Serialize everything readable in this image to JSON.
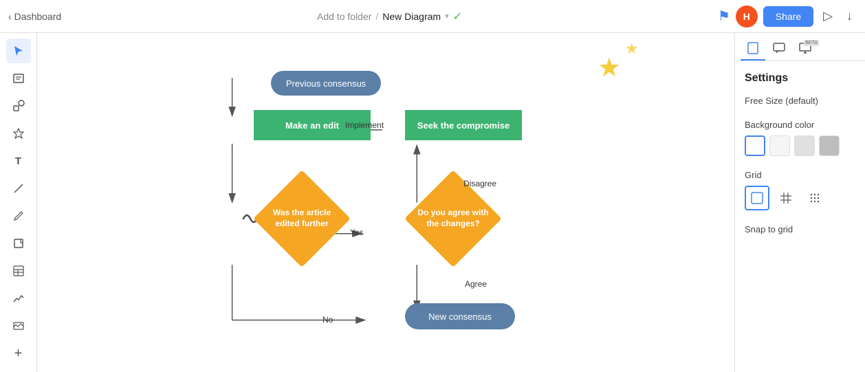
{
  "topbar": {
    "back_label": "Dashboard",
    "add_to_folder": "Add to folder",
    "separator": "/",
    "diagram_name": "New Diagram",
    "share_label": "Share",
    "avatar_letter": "H"
  },
  "left_sidebar": {
    "tools": [
      {
        "name": "cursor",
        "icon": "↖",
        "active": true
      },
      {
        "name": "notes",
        "icon": "☰"
      },
      {
        "name": "shapes",
        "icon": "⊞"
      },
      {
        "name": "star",
        "icon": "☆"
      },
      {
        "name": "text",
        "icon": "T"
      },
      {
        "name": "line",
        "icon": "/"
      },
      {
        "name": "pen",
        "icon": "✏"
      },
      {
        "name": "sticky",
        "icon": "🗒"
      },
      {
        "name": "table",
        "icon": "⊟"
      },
      {
        "name": "chart",
        "icon": "📈"
      },
      {
        "name": "image",
        "icon": "🖼"
      },
      {
        "name": "add",
        "icon": "+"
      }
    ]
  },
  "right_panel": {
    "title": "Settings",
    "tabs": [
      {
        "name": "page",
        "icon": "⬜"
      },
      {
        "name": "note",
        "icon": "💬"
      },
      {
        "name": "screen",
        "icon": "🖥",
        "badge": "BETA"
      }
    ],
    "free_size_label": "Free Size (default)",
    "background_color_label": "Background color",
    "colors": [
      {
        "id": "white",
        "value": "#ffffff",
        "selected": true
      },
      {
        "id": "light-gray",
        "value": "#f5f5f5"
      },
      {
        "id": "gray",
        "value": "#e0e0e0"
      },
      {
        "id": "dark-gray",
        "value": "#bdbdbd"
      }
    ],
    "grid_label": "Grid",
    "grid_options": [
      {
        "id": "none",
        "icon": "⬜",
        "selected": true
      },
      {
        "id": "hash",
        "icon": "#"
      },
      {
        "id": "dots",
        "icon": "⠿"
      }
    ],
    "snap_to_grid_label": "Snap to grid"
  },
  "diagram": {
    "nodes": [
      {
        "id": "prev-consensus",
        "label": "Previous consensus",
        "type": "pill"
      },
      {
        "id": "make-edit",
        "label": "Make an edit",
        "type": "rect"
      },
      {
        "id": "seek-compromise",
        "label": "Seek the compromise",
        "type": "rect"
      },
      {
        "id": "was-article",
        "label": "Was the article edited further",
        "type": "diamond"
      },
      {
        "id": "do-you-agree",
        "label": "Do you agree with the changes?",
        "type": "diamond"
      },
      {
        "id": "new-consensus",
        "label": "New consensus",
        "type": "pill-blue"
      }
    ],
    "arrow_labels": [
      {
        "id": "implement",
        "text": "Implement"
      },
      {
        "id": "disagree",
        "text": "Disagree"
      },
      {
        "id": "yes",
        "text": "Yes"
      },
      {
        "id": "agree",
        "text": "Agree"
      },
      {
        "id": "no",
        "text": "No"
      }
    ]
  }
}
